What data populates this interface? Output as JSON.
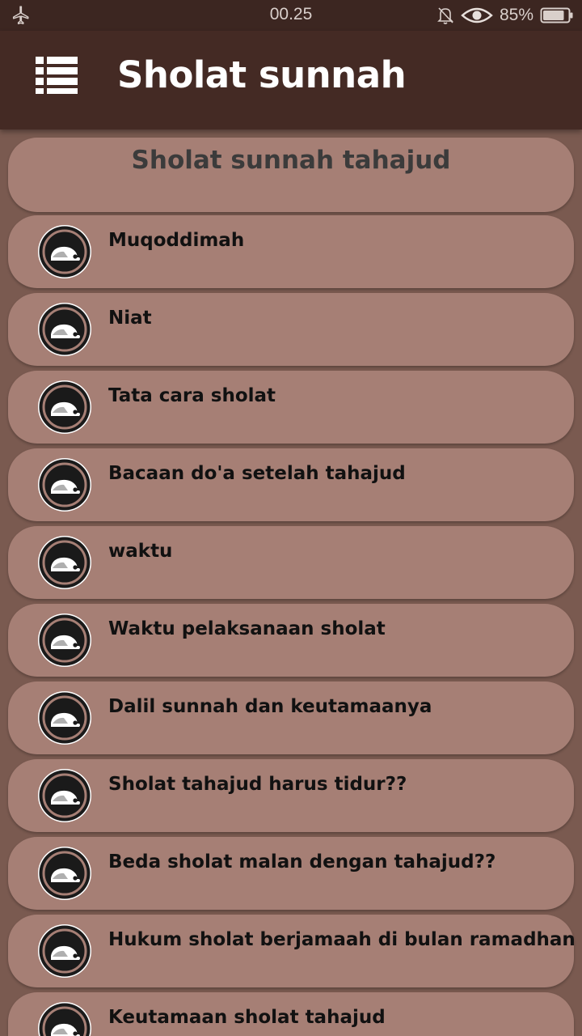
{
  "status_bar": {
    "time": "00.25",
    "battery_percent": "85%",
    "battery_level": 0.85,
    "icons": [
      "airplane-icon",
      "bell-off-icon",
      "eye-icon",
      "battery-icon"
    ]
  },
  "app_bar": {
    "title": "Sholat sunnah",
    "menu_icon": "list-menu-icon"
  },
  "section": {
    "title": "Sholat sunnah tahajud"
  },
  "items": [
    {
      "label": "Muqoddimah"
    },
    {
      "label": "Niat"
    },
    {
      "label": "Tata cara sholat"
    },
    {
      "label": "Bacaan do'a setelah tahajud"
    },
    {
      "label": "waktu"
    },
    {
      "label": "Waktu pelaksanaan sholat"
    },
    {
      "label": "Dalil sunnah dan keutamaanya"
    },
    {
      "label": "Sholat tahajud harus tidur??"
    },
    {
      "label": "Beda sholat malan dengan tahajud??"
    },
    {
      "label": "Hukum sholat berjamaah di bulan ramadhan"
    },
    {
      "label": "Keutamaan sholat tahajud"
    }
  ],
  "colors": {
    "status_bar_bg": "#3c2621",
    "app_bar_bg": "#442a24",
    "page_bg": "#7a5a50",
    "card_bg": "#a67f75",
    "item_text": "#111111",
    "header_text": "#3b3b3b"
  }
}
